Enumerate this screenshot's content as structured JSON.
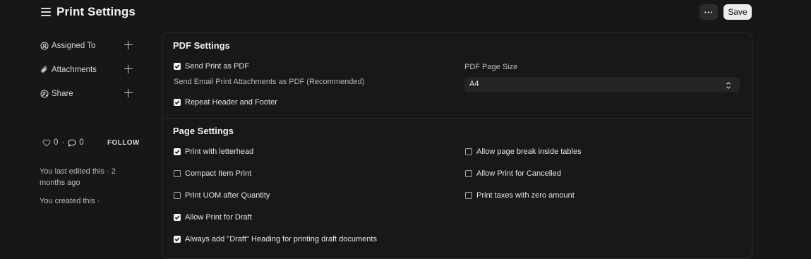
{
  "header": {
    "title": "Print Settings",
    "more_label": "···",
    "save_label": "Save"
  },
  "sidebar": {
    "items": [
      {
        "label": "Assigned To",
        "icon": "user-plus-icon"
      },
      {
        "label": "Attachments",
        "icon": "paperclip-icon"
      },
      {
        "label": "Share",
        "icon": "share-user-icon"
      }
    ],
    "likes": "0",
    "comments": "0",
    "separator": "·",
    "follow_label": "FOLLOW",
    "last_edited": "You last edited this · 2 months ago",
    "created": "You created this ·"
  },
  "pdf_settings": {
    "title": "PDF Settings",
    "send_print_as_pdf": {
      "label": "Send Print as PDF",
      "checked": true
    },
    "send_print_desc": "Send Email Print Attachments as PDF (Recommended)",
    "repeat_header_footer": {
      "label": "Repeat Header and Footer",
      "checked": true
    },
    "page_size_label": "PDF Page Size",
    "page_size_value": "A4"
  },
  "page_settings": {
    "title": "Page Settings",
    "left": [
      {
        "label": "Print with letterhead",
        "checked": true
      },
      {
        "label": "Compact Item Print",
        "checked": false
      },
      {
        "label": "Print UOM after Quantity",
        "checked": false
      },
      {
        "label": "Allow Print for Draft",
        "checked": true
      },
      {
        "label": "Always add \"Draft\" Heading for printing draft documents",
        "checked": true
      }
    ],
    "right": [
      {
        "label": "Allow page break inside tables",
        "checked": false
      },
      {
        "label": "Allow Print for Cancelled",
        "checked": false
      },
      {
        "label": "Print taxes with zero amount",
        "checked": false
      }
    ]
  }
}
